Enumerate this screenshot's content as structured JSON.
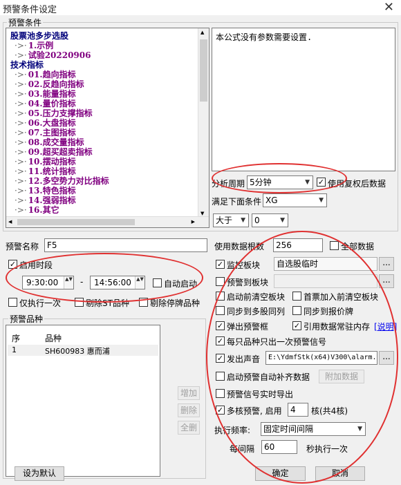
{
  "window": {
    "title": "预警条件设定",
    "close_glyph": "✕"
  },
  "conditions_group": {
    "label": "预警条件"
  },
  "tree": [
    {
      "kind": "cat",
      "label": "股票池多步选股"
    },
    {
      "kind": "item",
      "label": "1.示例"
    },
    {
      "kind": "item",
      "label": "试验20220906"
    },
    {
      "kind": "cat",
      "label": "技术指标"
    },
    {
      "kind": "item",
      "label": "01.趋向指标"
    },
    {
      "kind": "item",
      "label": "02.反趋向指标"
    },
    {
      "kind": "item",
      "label": "03.能量指标"
    },
    {
      "kind": "item",
      "label": "04.量价指标"
    },
    {
      "kind": "item",
      "label": "05.压力支撑指标"
    },
    {
      "kind": "item",
      "label": "06.大盘指标"
    },
    {
      "kind": "item",
      "label": "07.主图指标"
    },
    {
      "kind": "item",
      "label": "08.成交量指标"
    },
    {
      "kind": "item",
      "label": "09.超买超卖指标"
    },
    {
      "kind": "item",
      "label": "10.摆动指标"
    },
    {
      "kind": "item",
      "label": "11.统计指标"
    },
    {
      "kind": "item",
      "label": "12.多空势力对比指标"
    },
    {
      "kind": "item",
      "label": "13.特色指标"
    },
    {
      "kind": "item",
      "label": "14.强弱指标"
    },
    {
      "kind": "item",
      "label": "16.其它"
    }
  ],
  "tree_branch_glyph": "·>·",
  "param_desc": "本公式没有参数需要设置.",
  "period": {
    "label": "分析周期",
    "value": "5分钟",
    "adjusted_label": "使用复权后数据",
    "adjusted_checked": "✓"
  },
  "condition": {
    "label": "满足下面条件",
    "value": "XG"
  },
  "compare": {
    "op": "大于",
    "value": "0"
  },
  "alert_name": {
    "label": "预警名称",
    "value": "F5"
  },
  "time_period": {
    "label": "启用时段",
    "checked": "✓",
    "start": "9:30:00",
    "dash": "-",
    "end": "14:56:00",
    "auto_start_label": "自动启动"
  },
  "options": {
    "run_once": "仅执行一次",
    "exclude_st": "剔除ST品种",
    "exclude_suspended": "剔除停牌品种"
  },
  "stocks_group": {
    "label": "预警品种"
  },
  "stock_table": {
    "headers": [
      "序",
      "品种"
    ],
    "rows": [
      {
        "seq": "1",
        "code": "SH600983 惠而浦"
      }
    ]
  },
  "stock_buttons": {
    "add": "增加",
    "delete": "删除",
    "delete_all": "全删"
  },
  "data_count": {
    "label": "使用数据根数",
    "value": "256",
    "all_label": "全部数据"
  },
  "monitor": {
    "label": "监控板块",
    "checked": "✓",
    "value": "自选股临时",
    "alert_to_label": "预警到板块",
    "start_clear_label": "启动前清空板块",
    "first_clear_label": "首票加入前清空板块",
    "sync_multi": "同步到多股同列",
    "sync_quote": "同步到报价牌",
    "popup": "弹出预警框",
    "resident_mem": "引用数据常驻内存",
    "explain": "[说明]",
    "once_per_stock": "每只品种只出一次预警信号",
    "sound": "发出声音",
    "sound_path": "E:\\YdmfStk(x64)V300\\alarm.",
    "auto_fill": "启动预警自动补齐数据",
    "extra_data": "附加数据",
    "realtime_export": "预警信号实时导出",
    "multicore": "多核预警, 启用",
    "cores": "4",
    "cores_suffix": "核(共4核)",
    "freq_label": "执行频率:",
    "freq_value": "固定时间间隔",
    "interval_prefix": "每间隔",
    "interval": "60",
    "interval_suffix": "秒执行一次",
    "browse": "..."
  },
  "footer": {
    "default": "设为默认",
    "ok": "确定",
    "cancel": "取消"
  },
  "check_mark": "✓",
  "dropdown_glyph": "▼",
  "spin_glyph": "▲▼"
}
